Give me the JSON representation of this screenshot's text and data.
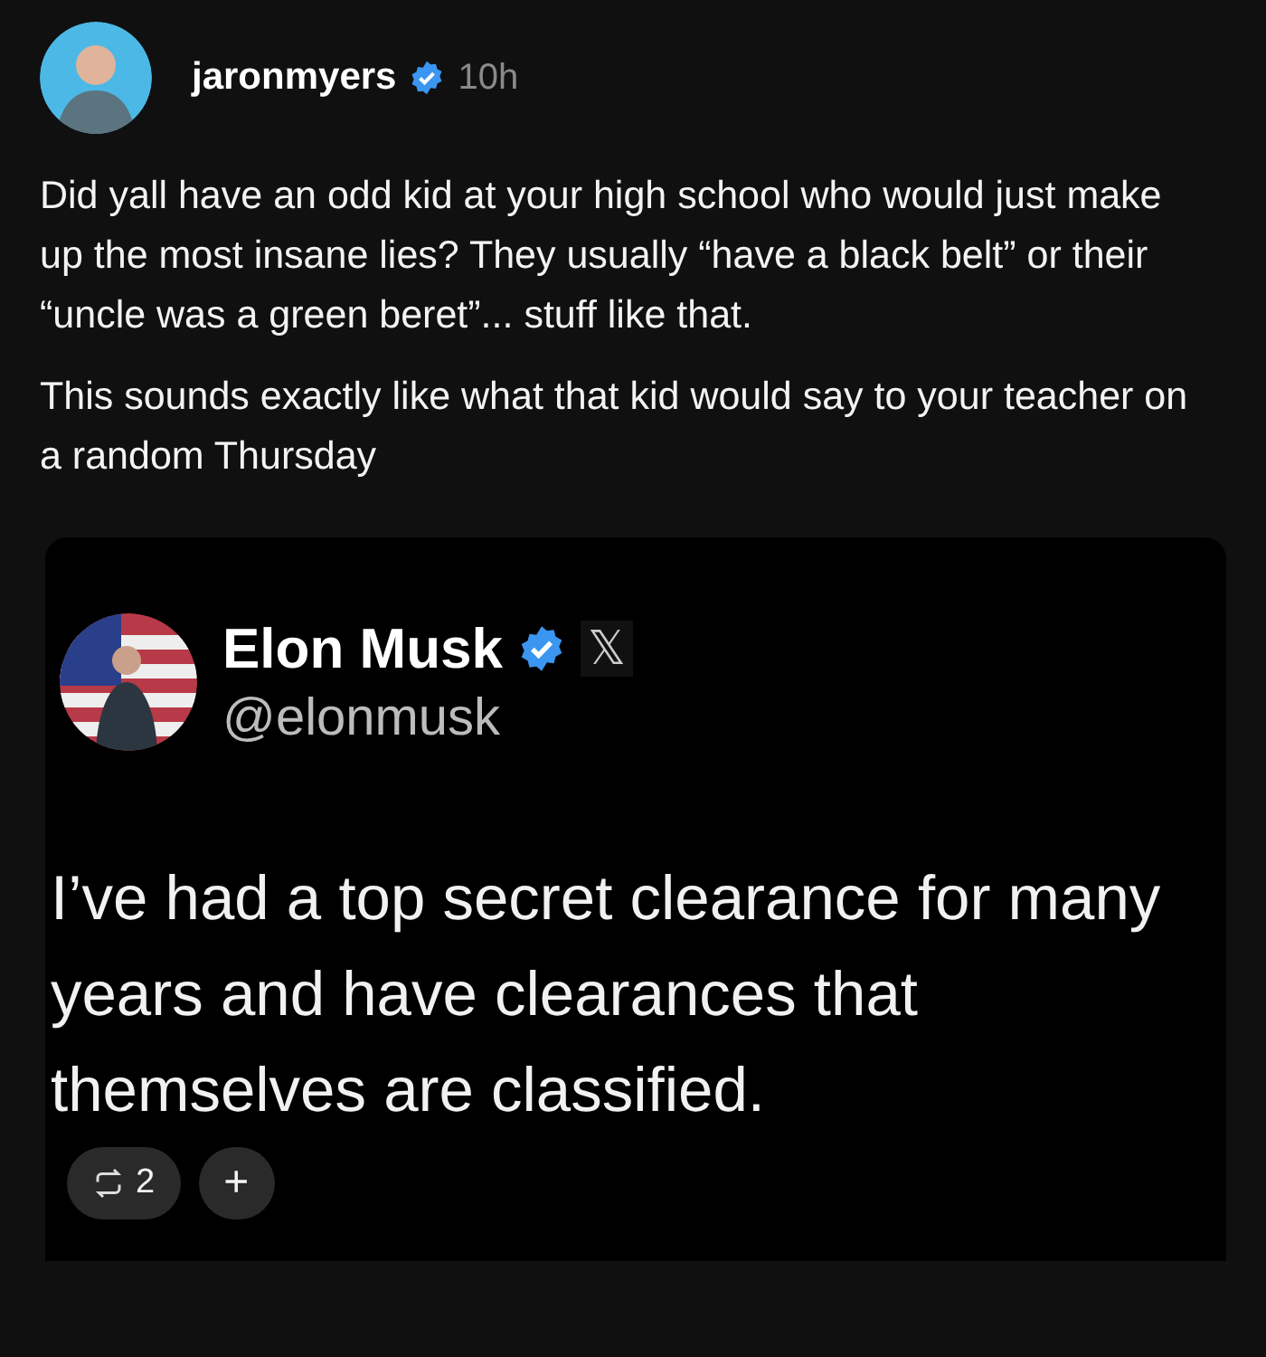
{
  "post": {
    "author": "jaronmyers",
    "verified": true,
    "time": "10h",
    "paragraphs": [
      "Did yall have an odd kid at your high school who would just make up the most insane lies? They usually “have a black belt” or their “uncle was a green beret”... stuff like that.",
      "This sounds exactly like what that kid would say to your teacher on a random Thursday"
    ]
  },
  "quote": {
    "name": "Elon Musk",
    "verified": true,
    "platform_mark": "𝕏",
    "handle": "@elonmusk",
    "text": "I’ve had a top secret clearance for many years and have clearances that themselves are classified."
  },
  "actions": [
    {
      "kind": "repost",
      "count": "2"
    },
    {
      "kind": "add",
      "label": "+"
    }
  ]
}
